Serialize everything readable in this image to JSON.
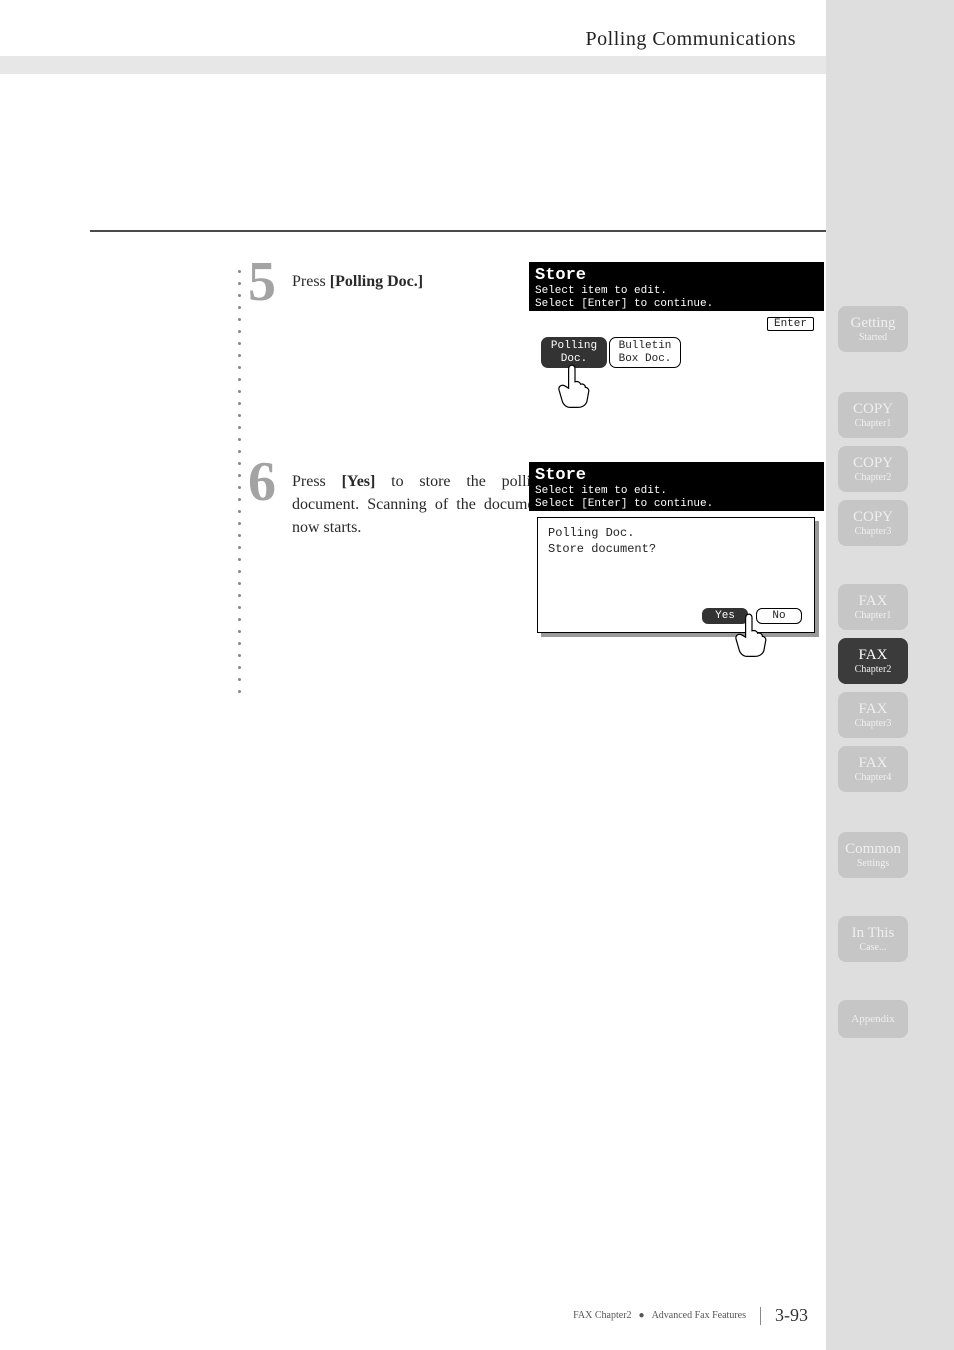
{
  "header": {
    "section_title": "Polling Communications"
  },
  "steps": [
    {
      "num": "5",
      "text_parts": [
        "Press ",
        "[Polling Doc.]"
      ],
      "bold_idx": 1
    },
    {
      "num": "6",
      "text_parts": [
        "Press ",
        "[Yes]",
        " to store the polling document. Scanning of the document now starts."
      ],
      "bold_idx": 1
    }
  ],
  "lcd1": {
    "title": "Store",
    "line1": "Select item to edit.",
    "line2": "Select [Enter] to continue.",
    "enter": "Enter",
    "btn1_line1": "Polling",
    "btn1_line2": "Doc.",
    "btn2_line1": "Bulletin",
    "btn2_line2": "Box Doc."
  },
  "lcd2": {
    "title": "Store",
    "line1": "Select item to edit.",
    "line2": "Select [Enter] to continue.",
    "popup_line1": "Polling Doc.",
    "popup_line2": "Store document?",
    "yes": "Yes",
    "no": "No"
  },
  "sidebar": [
    {
      "main": "Getting",
      "sub": "Started",
      "active": false
    },
    {
      "main": "COPY",
      "sub": "Chapter1",
      "active": false
    },
    {
      "main": "COPY",
      "sub": "Chapter2",
      "active": false
    },
    {
      "main": "COPY",
      "sub": "Chapter3",
      "active": false
    },
    {
      "main": "FAX",
      "sub": "Chapter1",
      "active": false
    },
    {
      "main": "FAX",
      "sub": "Chapter2",
      "active": true
    },
    {
      "main": "FAX",
      "sub": "Chapter3",
      "active": false
    },
    {
      "main": "FAX",
      "sub": "Chapter4",
      "active": false
    },
    {
      "main": "Common",
      "sub": "Settings",
      "active": false
    },
    {
      "main": "In This",
      "sub": "Case...",
      "active": false
    },
    {
      "main": "Appendix",
      "sub": "",
      "active": false
    }
  ],
  "footer": {
    "crumb1": "FAX Chapter2",
    "crumb2": "Advanced Fax Features",
    "page": "3-93"
  }
}
